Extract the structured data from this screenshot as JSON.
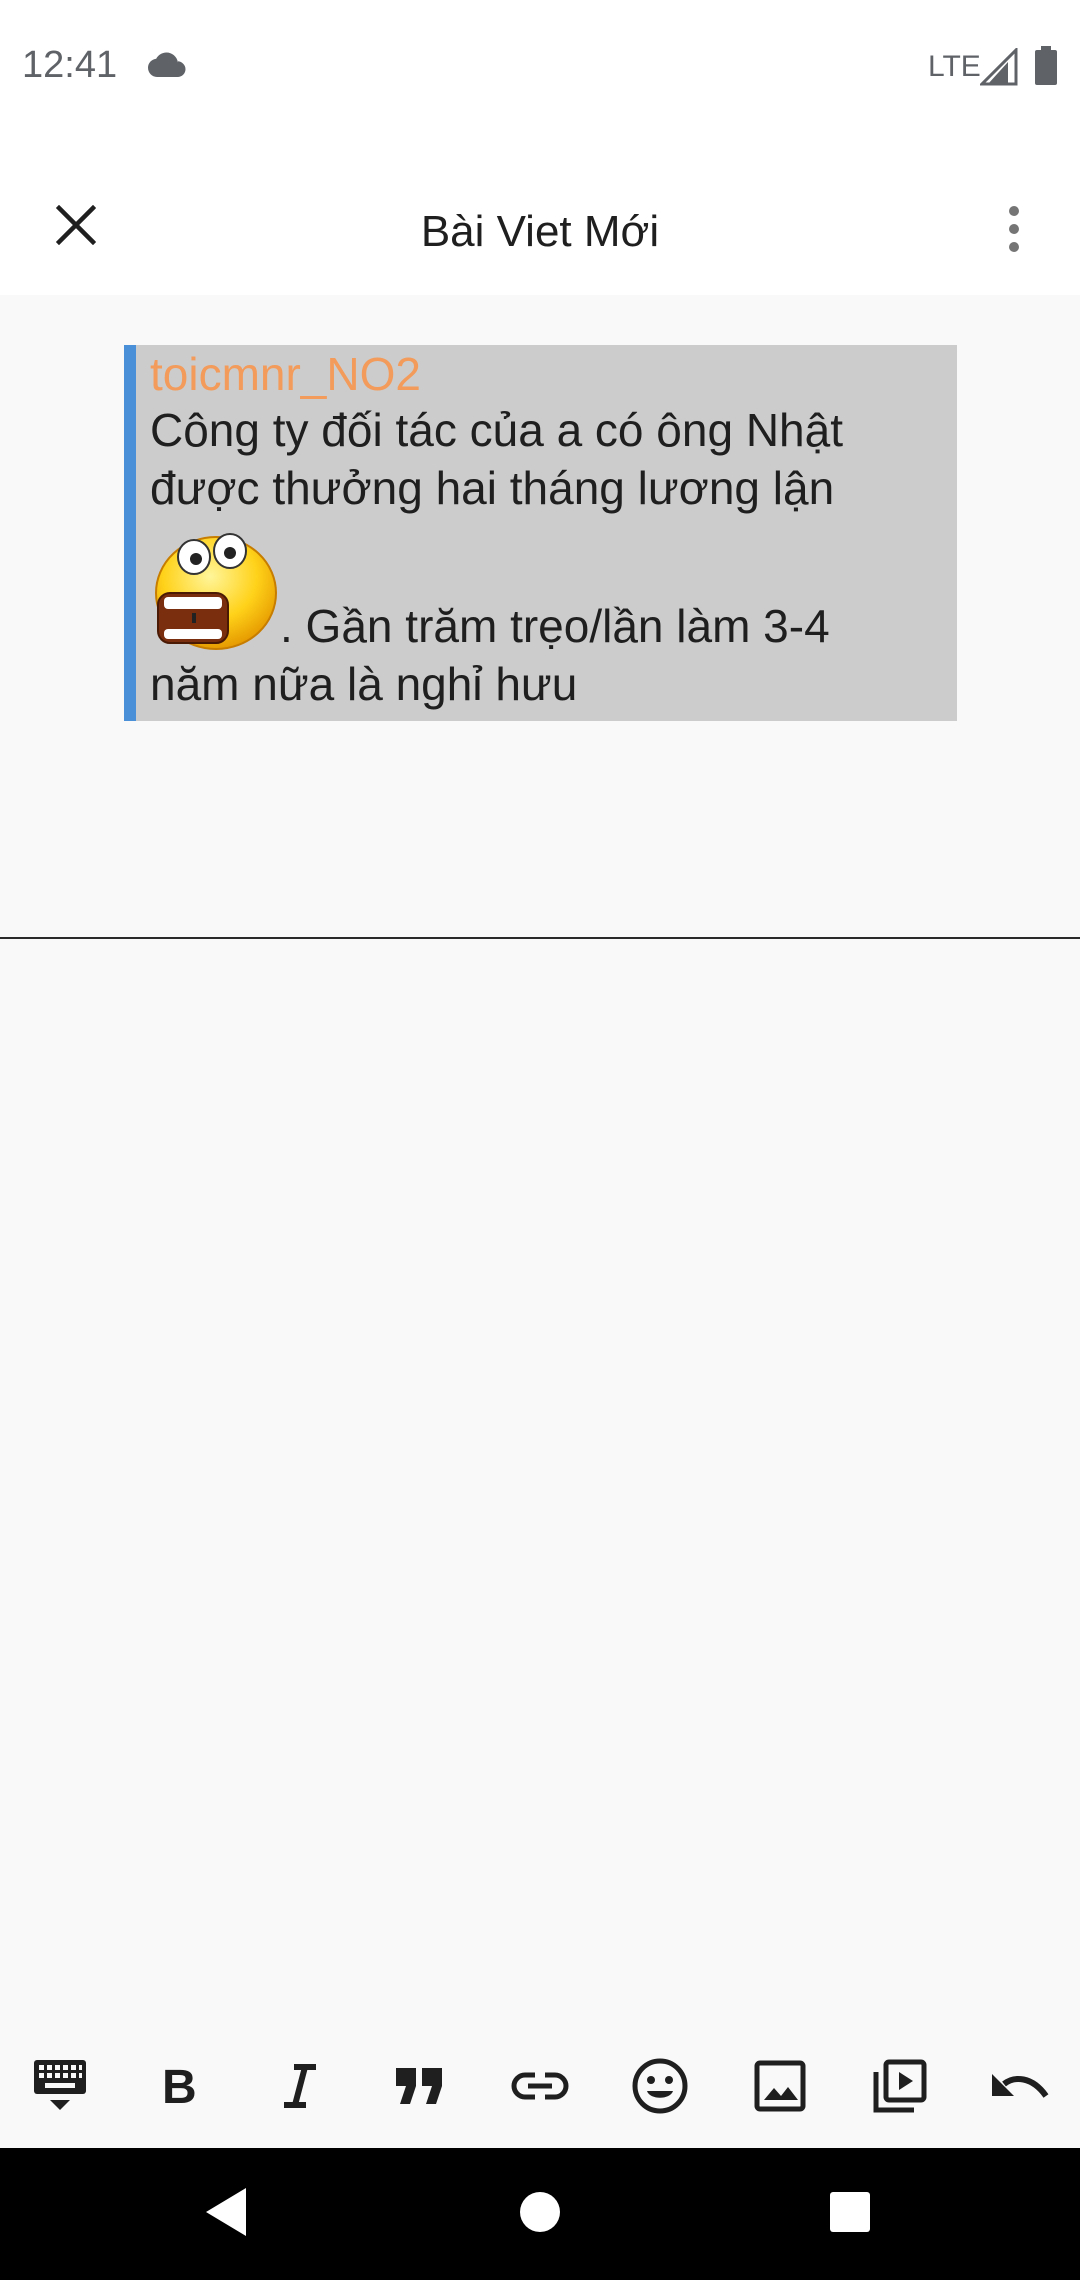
{
  "status_bar": {
    "time": "12:41",
    "network": "LTE",
    "icons": [
      "cloud-icon",
      "signal-icon",
      "battery-icon"
    ]
  },
  "app_bar": {
    "title": "Bài Viet Mới",
    "close_icon": "close-icon",
    "more_icon": "more-vert-icon"
  },
  "quote": {
    "username": "toicmnr_NO2",
    "line1": "Công ty đối tác của a có ông Nhật",
    "line2": "được thưởng hai tháng lương lận",
    "line3": ". Gần trăm trẹo/lần làm 3-4",
    "line4": "năm nữa là nghỉ hưu",
    "emoji": "shocked-emoji",
    "accent_color": "#4a90d9",
    "username_color": "#f39b5a",
    "background": "#cccccc"
  },
  "toolbar": {
    "items": [
      "keyboard-hide-icon",
      "bold-icon",
      "italic-icon",
      "quote-icon",
      "link-icon",
      "emoji-icon",
      "image-icon",
      "video-icon",
      "undo-icon"
    ]
  },
  "nav_bar": {
    "items": [
      "back-icon",
      "home-icon",
      "recents-icon"
    ]
  }
}
